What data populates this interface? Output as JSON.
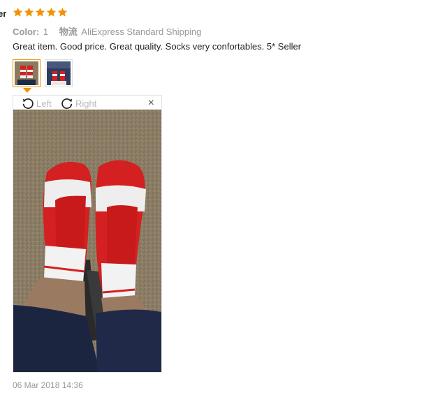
{
  "review": {
    "user_label": "er",
    "rating": 5,
    "color_label": "Color:",
    "color_value": "1",
    "shipping_label": "物流",
    "shipping_value": "AliExpress Standard Shipping",
    "text": "Great item. Good price. Great quality. Socks very confortables. 5* Seller",
    "date": "06 Mar 2018 14:36"
  },
  "viewer": {
    "rotate_left_label": "Left",
    "rotate_right_label": "Right",
    "close_glyph": "×"
  },
  "colors": {
    "star": "#f29200",
    "active_thumb_border": "#f29200",
    "muted_text": "#999999"
  },
  "icons": [
    "star-icon",
    "rotate-left-icon",
    "rotate-right-icon",
    "close-icon"
  ]
}
